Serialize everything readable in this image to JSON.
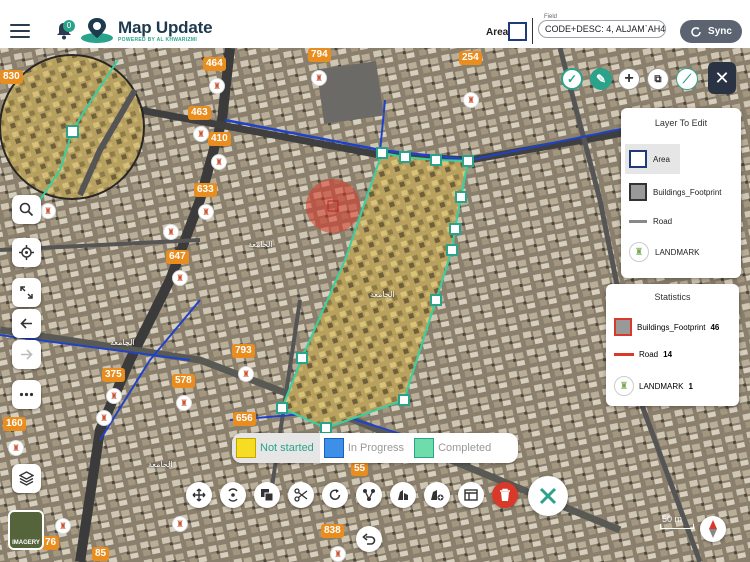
{
  "header": {
    "notification_count": "0",
    "logo_title": "Map Update",
    "logo_subtitle": "POWERED BY AL KHWARIZMI",
    "area_label": "Area",
    "field_caption": "Field",
    "field_value": "CODE+DESC:  4,  ALJAM`AH4",
    "sync_label": "Sync"
  },
  "layers_panel": {
    "title": "Layer To Edit",
    "items": [
      {
        "label": "Area",
        "icon": "area-swatch"
      },
      {
        "label": "Buildings_Footprint",
        "icon": "building-swatch"
      },
      {
        "label": "Road",
        "icon": "road-line"
      },
      {
        "label": "LANDMARK",
        "icon": "landmark-icon"
      }
    ]
  },
  "stats_panel": {
    "title": "Statistics",
    "items": [
      {
        "label": "Buildings_Footprint",
        "count": "46"
      },
      {
        "label": "Road",
        "count": "14"
      },
      {
        "label": "LANDMARK",
        "count": "1"
      }
    ]
  },
  "status_legend": {
    "not_started": "Not started",
    "in_progress": "In Progress",
    "completed": "Completed"
  },
  "map_labels": [
    {
      "text": "794"
    },
    {
      "text": "254"
    },
    {
      "text": "830"
    },
    {
      "text": "464"
    },
    {
      "text": "463"
    },
    {
      "text": "410"
    },
    {
      "text": "633"
    },
    {
      "text": "647"
    },
    {
      "text": "793"
    },
    {
      "text": "375"
    },
    {
      "text": "578"
    },
    {
      "text": "656"
    },
    {
      "text": "160"
    },
    {
      "text": "55"
    },
    {
      "text": "838"
    },
    {
      "text": "76"
    },
    {
      "text": "85"
    }
  ],
  "scale_text": "50 m",
  "imagery_label": "IMAGERY",
  "colors": {
    "accent": "#2aa38a",
    "not_started": "#f7dc24",
    "in_progress": "#3d8fe8",
    "completed": "#6fdcac",
    "label_orange": "#e98d1f"
  }
}
